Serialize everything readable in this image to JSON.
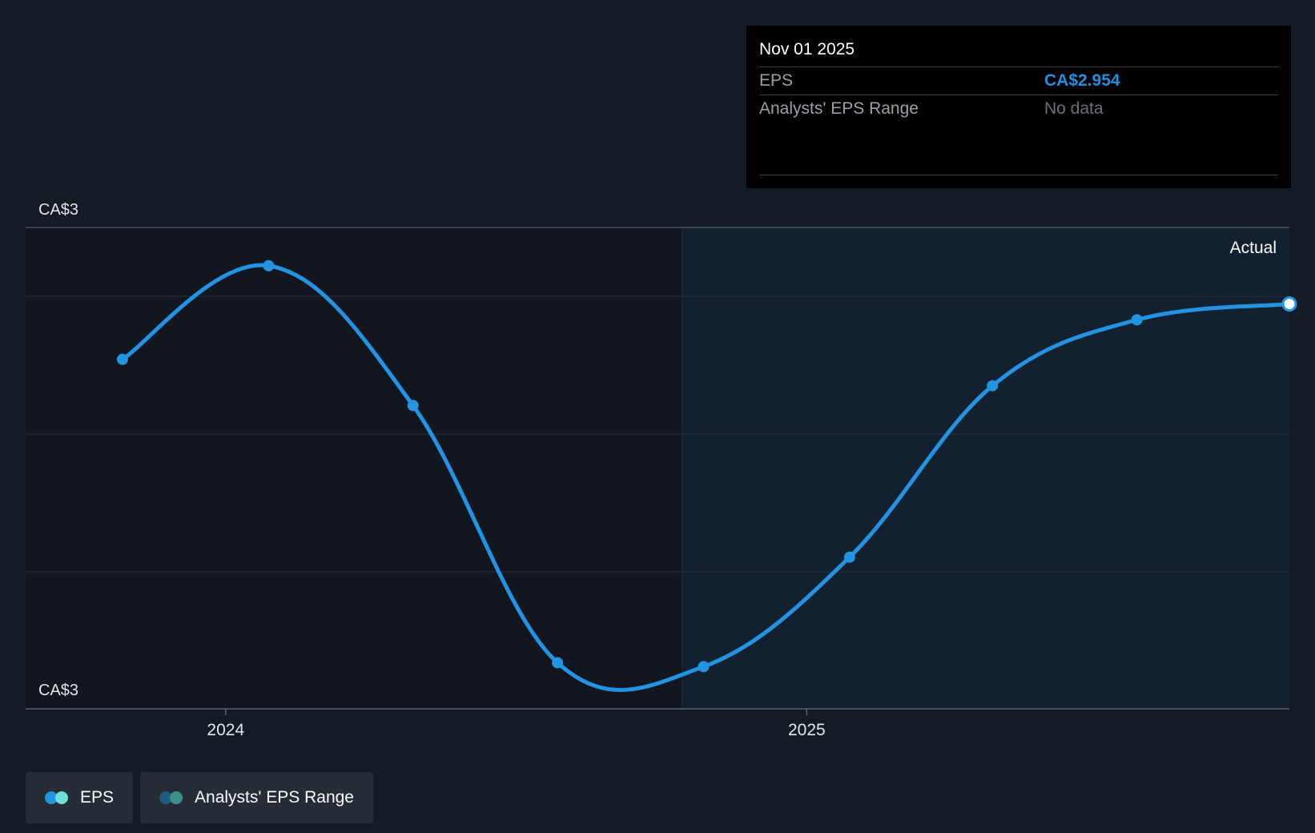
{
  "chart_data": {
    "type": "line",
    "series": [
      {
        "name": "EPS",
        "color": "#2394e4",
        "points": [
          {
            "x": "2023-10-28",
            "y": 2.87
          },
          {
            "x": "2024-01-28",
            "y": 3.012
          },
          {
            "x": "2024-04-28",
            "y": 2.8
          },
          {
            "x": "2024-07-28",
            "y": 2.41
          },
          {
            "x": "2024-10-28",
            "y": 2.404
          },
          {
            "x": "2025-01-28",
            "y": 2.57
          },
          {
            "x": "2025-04-28",
            "y": 2.83
          },
          {
            "x": "2025-07-28",
            "y": 2.93
          },
          {
            "x": "2025-11-01",
            "y": 2.954
          }
        ]
      }
    ],
    "x_ticks": [
      "2024",
      "2025"
    ],
    "y_axis": {
      "top_label": "CA$3",
      "bottom_label": "CA$3",
      "ylim": [
        2.34,
        3.07
      ]
    },
    "region_label": "Actual",
    "grid": true
  },
  "tooltip": {
    "date": "Nov 01 2025",
    "rows": [
      {
        "label": "EPS",
        "value": "CA$2.954"
      },
      {
        "label": "Analysts' EPS Range",
        "value": "No data"
      }
    ]
  },
  "legend": {
    "items": [
      {
        "label": "EPS",
        "color_a": "#2394e4",
        "color_b": "#6fe0d8"
      },
      {
        "label": "Analysts' EPS Range",
        "color_a": "#1f5a80",
        "color_b": "#3f8f8a"
      }
    ]
  },
  "colors": {
    "background": "#151b24",
    "past_region": "#12161e",
    "actual_region": "#13202f",
    "line": "#2394e4",
    "grid": "#2a323d"
  }
}
